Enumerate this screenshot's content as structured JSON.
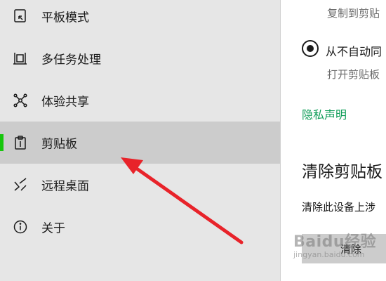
{
  "sidebar": {
    "items": [
      {
        "label": "平板模式",
        "icon": "tablet-mode-icon"
      },
      {
        "label": "多任务处理",
        "icon": "multitasking-icon"
      },
      {
        "label": "体验共享",
        "icon": "shared-experiences-icon"
      },
      {
        "label": "剪贴板",
        "icon": "clipboard-icon",
        "selected": true
      },
      {
        "label": "远程桌面",
        "icon": "remote-desktop-icon"
      },
      {
        "label": "关于",
        "icon": "info-icon"
      }
    ]
  },
  "main": {
    "sync_desc": "复制到剪贴",
    "radio_label": "从不自动同",
    "radio_desc": "打开剪贴板",
    "privacy_link": "隐私声明",
    "clear_title": "清除剪贴板",
    "clear_desc": "清除此设备上涉",
    "clear_button": "清除"
  },
  "watermark": {
    "logo": "Baidu经验",
    "sub": "jingyan.baidu.com"
  },
  "colors": {
    "sidebar_bg": "#e6e6e6",
    "selected_bg": "#cccccc",
    "accent": "#16c60c",
    "link": "#0f9d58",
    "arrow": "#e8232a"
  }
}
